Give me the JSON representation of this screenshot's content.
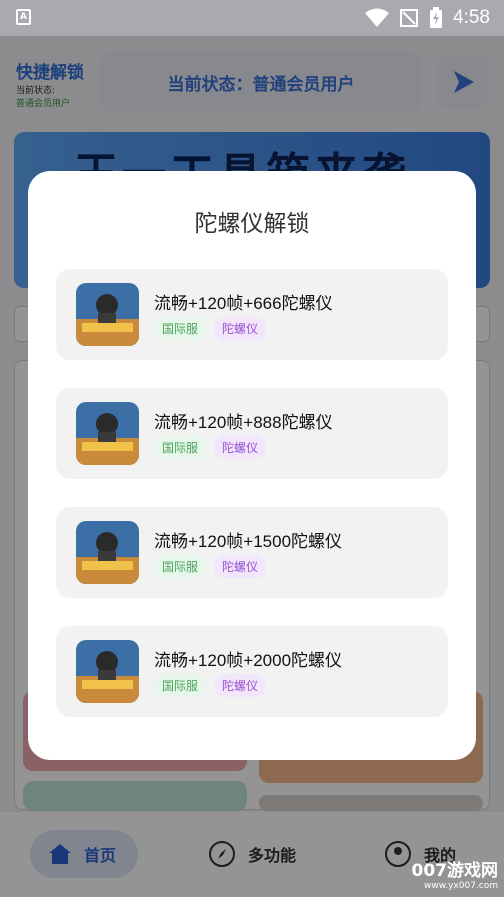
{
  "status_bar": {
    "time": "4:58",
    "app_icon": "A"
  },
  "app": {
    "title": "快捷解锁",
    "status_caption": "当前状态:",
    "status_value": "普通会员用户",
    "status_banner": "当前状态：普通会员用户",
    "banner_text": "王一工具箱来袭"
  },
  "bottom_nav": [
    {
      "label": "首页",
      "icon": "home-icon"
    },
    {
      "label": "多功能",
      "icon": "compass-icon"
    },
    {
      "label": "我的",
      "icon": "user-icon"
    }
  ],
  "watermark": {
    "brand": "007游戏网",
    "url": "www.yx007.com"
  },
  "dialog": {
    "title": "陀螺仪解锁",
    "items": [
      {
        "name": "流畅+120帧+666陀螺仪",
        "tags": [
          "国际服",
          "陀螺仪"
        ]
      },
      {
        "name": "流畅+120帧+888陀螺仪",
        "tags": [
          "国际服",
          "陀螺仪"
        ]
      },
      {
        "name": "流畅+120帧+1500陀螺仪",
        "tags": [
          "国际服",
          "陀螺仪"
        ]
      },
      {
        "name": "流畅+120帧+2000陀螺仪",
        "tags": [
          "国际服",
          "陀螺仪"
        ]
      }
    ]
  },
  "colors": {
    "accent": "#2f6fd6",
    "region_tag": "#4aa35a",
    "gyro_tag": "#9b4fd3"
  }
}
